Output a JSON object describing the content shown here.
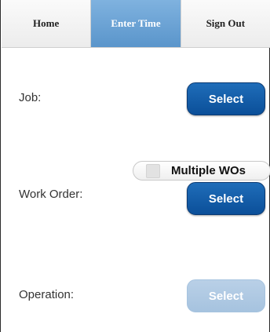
{
  "nav": {
    "tabs": [
      {
        "label": "Home"
      },
      {
        "label": "Enter Time",
        "active": true
      },
      {
        "label": "Sign Out"
      }
    ]
  },
  "form": {
    "job": {
      "label": "Job:",
      "button": "Select"
    },
    "multiple_wos": {
      "label": "Multiple WOs",
      "checked": false
    },
    "work_order": {
      "label": "Work Order:",
      "button": "Select"
    },
    "operation": {
      "label": "Operation:",
      "button": "Select",
      "disabled": true
    }
  },
  "colors": {
    "accent_tab": "#6aa3d6",
    "primary_button": "#0b5aa8",
    "disabled_button": "#aecae4"
  }
}
